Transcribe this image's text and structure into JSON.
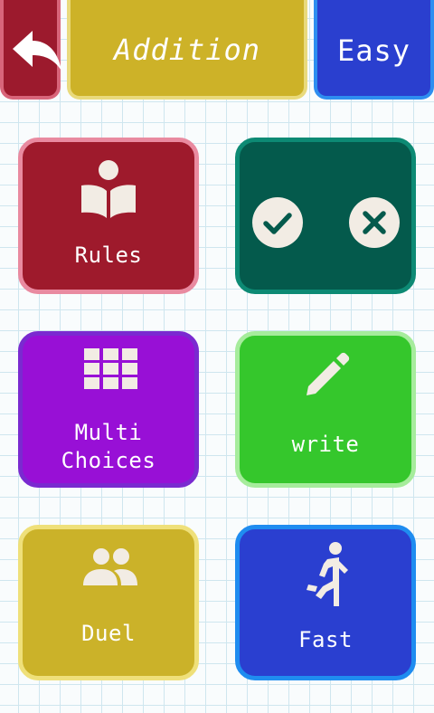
{
  "header": {
    "mode_title": "Addition",
    "level_label": "Easy"
  },
  "menu": {
    "rules_label": "Rules",
    "multi_choices_label": "Multi\nChoices",
    "write_label": "write",
    "duel_label": "Duel",
    "fast_label": "Fast"
  },
  "icons": {
    "back": "back-arrow-icon",
    "rules": "book-reader-icon",
    "true_false_check": "check-circle-icon",
    "true_false_cross": "cross-circle-icon",
    "multi_choices": "grid-icon",
    "write": "pencil-icon",
    "duel": "group-icon",
    "fast": "running-person-icon"
  },
  "colors": {
    "back_red": "#9c1a2d",
    "title_yellow": "#cdb228",
    "easy_blue": "#2a3fcf",
    "rules_red": "#9e1a2c",
    "truefalse_green": "#045a4c",
    "multi_purple": "#9810d6",
    "write_green": "#35c72c",
    "duel_yellow": "#cbb229",
    "fast_blue": "#2a3fd0"
  }
}
